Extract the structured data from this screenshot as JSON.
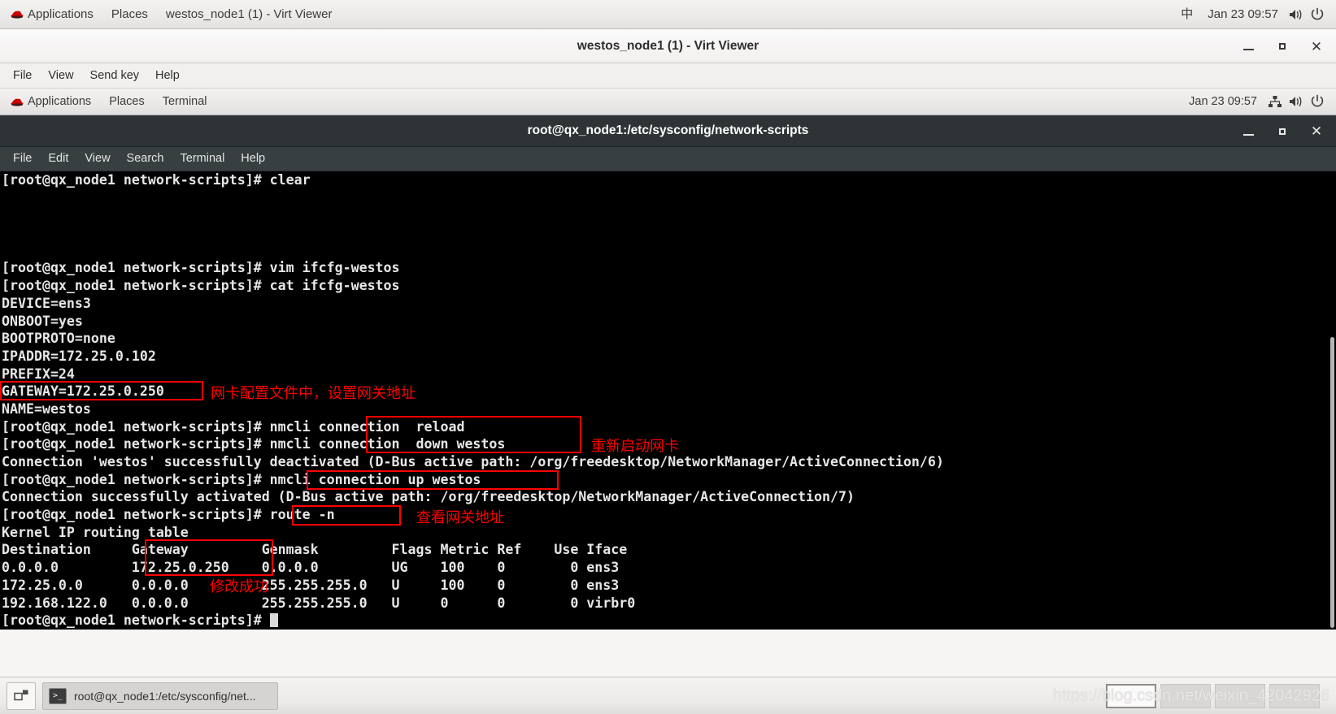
{
  "host_panel": {
    "logo": "redhat-logo",
    "items": [
      "Applications",
      "Places"
    ],
    "window_title": "westos_node1 (1) - Virt Viewer",
    "ime": "中",
    "clock": "Jan 23 09:57",
    "volume_icon": "volume-icon",
    "power_icon": "power-icon"
  },
  "virt_viewer": {
    "title": "westos_node1 (1) - Virt Viewer",
    "menu": [
      "File",
      "View",
      "Send key",
      "Help"
    ],
    "minimize_icon": "minimize-icon",
    "maximize_icon": "maximize-icon",
    "close_icon": "close-icon"
  },
  "guest_panel": {
    "logo": "redhat-logo",
    "items": [
      "Applications",
      "Places",
      "Terminal"
    ],
    "clock": "Jan 23 09:57",
    "network_icon": "network-icon",
    "volume_icon": "volume-icon",
    "power_icon": "power-icon"
  },
  "terminal": {
    "title": "root@qx_node1:/etc/sysconfig/network-scripts",
    "menu": [
      "File",
      "Edit",
      "View",
      "Search",
      "Terminal",
      "Help"
    ],
    "minimize_icon": "minimize-icon",
    "maximize_icon": "maximize-icon",
    "close_icon": "close-icon",
    "prompt": "[root@qx_node1 network-scripts]#",
    "lines": [
      "[root@qx_node1 network-scripts]# clear",
      "",
      "",
      "",
      "",
      "[root@qx_node1 network-scripts]# vim ifcfg-westos",
      "[root@qx_node1 network-scripts]# cat ifcfg-westos",
      "DEVICE=ens3",
      "ONBOOT=yes",
      "BOOTPROTO=none",
      "IPADDR=172.25.0.102",
      "PREFIX=24",
      "GATEWAY=172.25.0.250",
      "NAME=westos",
      "[root@qx_node1 network-scripts]# nmcli connection  reload",
      "[root@qx_node1 network-scripts]# nmcli connection  down westos",
      "Connection 'westos' successfully deactivated (D-Bus active path: /org/freedesktop/NetworkManager/ActiveConnection/6)",
      "[root@qx_node1 network-scripts]# nmcli connection up westos",
      "Connection successfully activated (D-Bus active path: /org/freedesktop/NetworkManager/ActiveConnection/7)",
      "[root@qx_node1 network-scripts]# route -n",
      "Kernel IP routing table",
      "Destination     Gateway         Genmask         Flags Metric Ref    Use Iface",
      "0.0.0.0         172.25.0.250    0.0.0.0         UG    100    0        0 ens3",
      "172.25.0.0      0.0.0.0         255.255.255.0   U     100    0        0 ens3",
      "192.168.122.0   0.0.0.0         255.255.255.0   U     0      0        0 virbr0",
      "[root@qx_node1 network-scripts]# "
    ],
    "scrollbar": "vertical-scrollbar"
  },
  "annotations": {
    "color": "#ff0000",
    "items": [
      {
        "id": "gateway-config",
        "text": "网卡配置文件中，设置网关地址"
      },
      {
        "id": "restart-nic",
        "text": "重新启动网卡"
      },
      {
        "id": "view-gateway",
        "text": "查看网关地址"
      },
      {
        "id": "modify-success",
        "text": "修改成功"
      }
    ]
  },
  "taskbar": {
    "show_desktop_icon": "show-desktop-icon",
    "task_icon": "terminal-icon",
    "task_label": "root@qx_node1:/etc/sysconfig/net...",
    "workspace_count": 4,
    "active_workspace": 1,
    "watermark": "https://blog.csdn.net/weixin_42042926"
  }
}
